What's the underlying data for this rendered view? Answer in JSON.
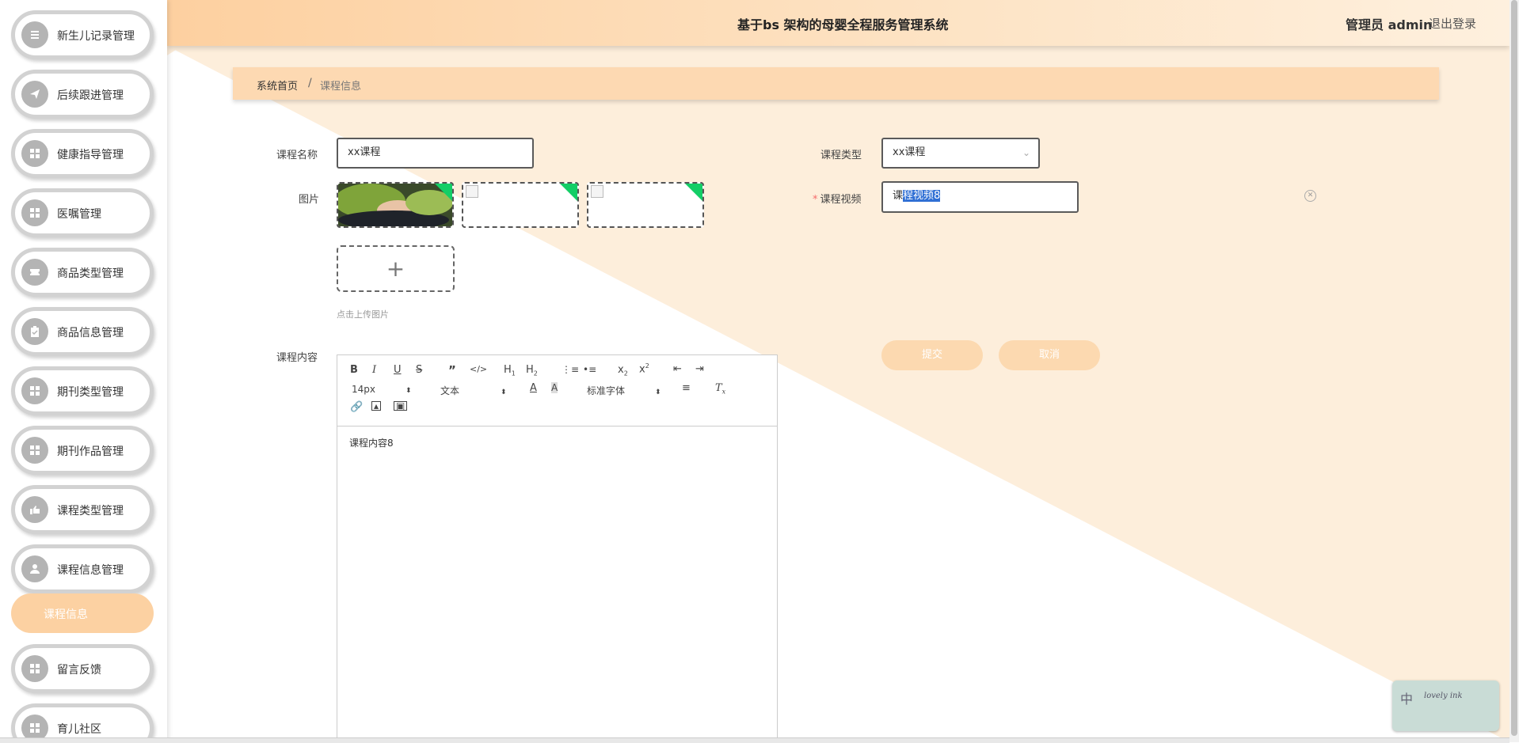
{
  "app": {
    "title": "基于bs 架构的母婴全程服务管理系统",
    "user": "管理员 admin",
    "logout": "退出登录"
  },
  "sidebar": {
    "items": [
      {
        "label": "新生儿记录管理",
        "icon": "list-icon"
      },
      {
        "label": "后续跟进管理",
        "icon": "send-icon"
      },
      {
        "label": "健康指导管理",
        "icon": "grid-icon"
      },
      {
        "label": "医嘱管理",
        "icon": "grid-icon"
      },
      {
        "label": "商品类型管理",
        "icon": "ticket-icon"
      },
      {
        "label": "商品信息管理",
        "icon": "clipboard-icon"
      },
      {
        "label": "期刊类型管理",
        "icon": "grid-icon"
      },
      {
        "label": "期刊作品管理",
        "icon": "grid-icon"
      },
      {
        "label": "课程类型管理",
        "icon": "hand-icon"
      },
      {
        "label": "课程信息管理",
        "icon": "user-icon"
      },
      {
        "label": "留言反馈",
        "icon": "grid-icon"
      },
      {
        "label": "育儿社区",
        "icon": "grid-icon"
      }
    ],
    "active_sub": "课程信息"
  },
  "breadcrumb": {
    "home": "系统首页",
    "separator": "/",
    "current": "课程信息"
  },
  "form": {
    "name_label": "课程名称",
    "name_value": "xx课程",
    "type_label": "课程类型",
    "type_value": "xx课程",
    "image_label": "图片",
    "video_label": "课程视频",
    "video_value_prefix": "课",
    "video_value_selected": "程视频8",
    "upload_tip": "点击上传图片",
    "content_label": "课程内容",
    "content_value": "课程内容8",
    "submit": "提交",
    "cancel": "取消"
  },
  "editor": {
    "font_size": "14px",
    "paragraph": "文本",
    "font_family": "标准字体"
  },
  "widget": {
    "lang": "中",
    "brand": "lovely ink"
  },
  "colors": {
    "accent": "#fdd0a0",
    "active": "#fcd1a2",
    "success": "#13ce66"
  }
}
